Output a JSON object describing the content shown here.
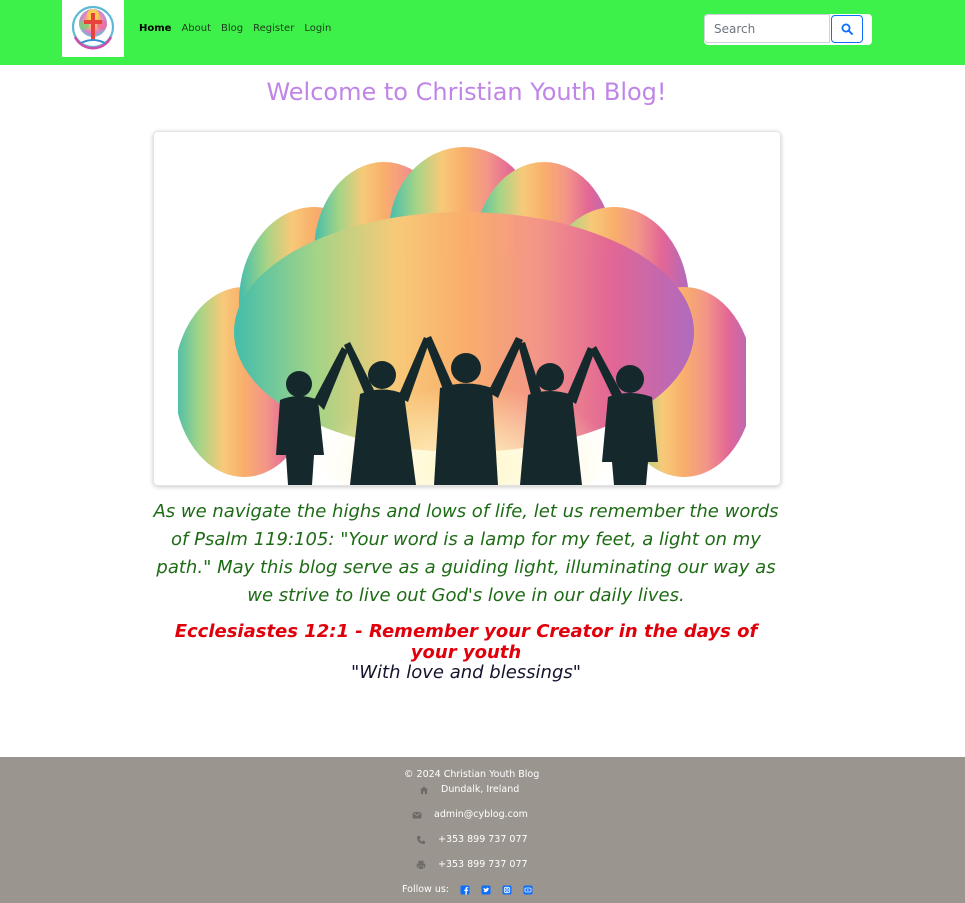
{
  "nav": {
    "logo_alt": "Christian Youth Blog logo",
    "links": [
      {
        "label": "Home",
        "active": true
      },
      {
        "label": "About",
        "active": false
      },
      {
        "label": "Blog",
        "active": false
      },
      {
        "label": "Register",
        "active": false
      },
      {
        "label": "Login",
        "active": false
      }
    ],
    "search_placeholder": "Search",
    "search_icon": "search-icon"
  },
  "main": {
    "title": "Welcome to Christian Youth Blog!",
    "hero_image_alt": "Silhouettes of youth raising joined hands before rainbow-colored trees",
    "quote": "As we navigate the highs and lows of life, let us remember the words of Psalm 119:105: \"Your word is a lamp for my feet, a light on my path.\" May this blog serve as a guiding light, illuminating our way as we strive to live out God's love in our daily lives.",
    "verse": "Ecclesiastes 12:1 - Remember your Creator in the days of your youth",
    "signoff": "\"With love and blessings\""
  },
  "footer": {
    "copyright": "© 2024 Christian Youth Blog",
    "address": "Dundalk, Ireland",
    "email": "admin@cyblog.com",
    "phone": "+353 899 737 077",
    "fax": "+353 899 737 077",
    "follow_label": "Follow us:",
    "social_icons": [
      "facebook-icon",
      "twitter-icon",
      "instagram-icon",
      "youtube-icon"
    ]
  },
  "colors": {
    "navbar_bg": "#3ef04a",
    "title": "#c085e6",
    "quote": "#1e6b16",
    "verse": "#e0000b",
    "footer_bg": "#9b958f",
    "social_icon": "#0d6efd"
  }
}
